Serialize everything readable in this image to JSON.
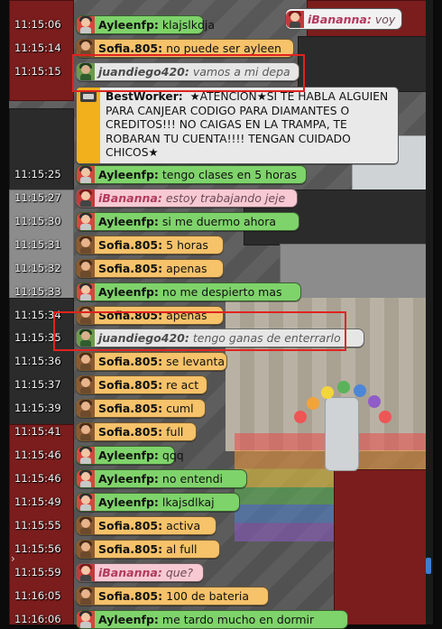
{
  "top_right_message": {
    "name": "iBananna:",
    "text": "voy",
    "style": "pink"
  },
  "announcement": {
    "name": "BestWorker:",
    "text": "★ATENCION★SI TE HABLA ALGUIEN PARA CANJEAR CODIGO PARA DIAMANTES O CREDITOS!!! NO CAIGAS EN LA TRAMPA, TE ROBARAN TU CUENTA!!!! TENGAN CUIDADO CHICOS★"
  },
  "messages": [
    {
      "time": "11:15:06",
      "name": "Ayleenfp:",
      "text": "klajslkdja",
      "style": "green"
    },
    {
      "time": "11:15:14",
      "name": "Sofia.805:",
      "text": "no puede ser ayleen",
      "style": "orange"
    },
    {
      "time": "11:15:15",
      "name": "juandiego420:",
      "text": "vamos a mi depa",
      "style": "grey"
    },
    {
      "time": "11:15:25",
      "name": "Ayleenfp:",
      "text": "tengo clases en 5 horas",
      "style": "green"
    },
    {
      "time": "11:15:27",
      "name": "iBananna:",
      "text": "estoy trabajando jeje",
      "style": "pink"
    },
    {
      "time": "11:15:30",
      "name": "Ayleenfp:",
      "text": "si me duermo ahora",
      "style": "green"
    },
    {
      "time": "11:15:31",
      "name": "Sofia.805:",
      "text": " 5 horas",
      "style": "orange"
    },
    {
      "time": "11:15:32",
      "name": "Sofia.805:",
      "text": "apenas",
      "style": "orange"
    },
    {
      "time": "11:15:33",
      "name": "Ayleenfp:",
      "text": "no me despierto mas",
      "style": "green"
    },
    {
      "time": "11:15:34",
      "name": "Sofia.805:",
      "text": "apenas",
      "style": "orange"
    },
    {
      "time": "11:15:35",
      "name": "juandiego420:",
      "text": "tengo ganas de enterrarlo",
      "style": "grey"
    },
    {
      "time": "11:15:36",
      "name": "Sofia.805:",
      "text": "se levanta",
      "style": "orange"
    },
    {
      "time": "11:15:37",
      "name": "Sofia.805:",
      "text": "re act",
      "style": "orange"
    },
    {
      "time": "11:15:39",
      "name": "Sofia.805:",
      "text": "cuml",
      "style": "orange"
    },
    {
      "time": "11:15:41",
      "name": "Sofia.805:",
      "text": "full",
      "style": "orange"
    },
    {
      "time": "11:15:46",
      "name": "Ayleenfp:",
      "text": "qqq",
      "style": "green"
    },
    {
      "time": "11:15:46",
      "name": "Ayleenfp:",
      "text": "no entendi",
      "style": "green"
    },
    {
      "time": "11:15:49",
      "name": "Ayleenfp:",
      "text": "lkajsdlkaj",
      "style": "green"
    },
    {
      "time": "11:15:55",
      "name": "Sofia.805:",
      "text": " activa",
      "style": "orange"
    },
    {
      "time": "11:15:56",
      "name": "Sofia.805:",
      "text": "al full",
      "style": "orange"
    },
    {
      "time": "11:15:59",
      "name": "iBananna:",
      "text": "que?",
      "style": "pink"
    },
    {
      "time": "11:16:05",
      "name": "Sofia.805:",
      "text": "100 de bateria",
      "style": "orange"
    },
    {
      "time": "11:16:06",
      "name": "Ayleenfp:",
      "text": "me tardo mucho en dormir",
      "style": "green"
    }
  ]
}
